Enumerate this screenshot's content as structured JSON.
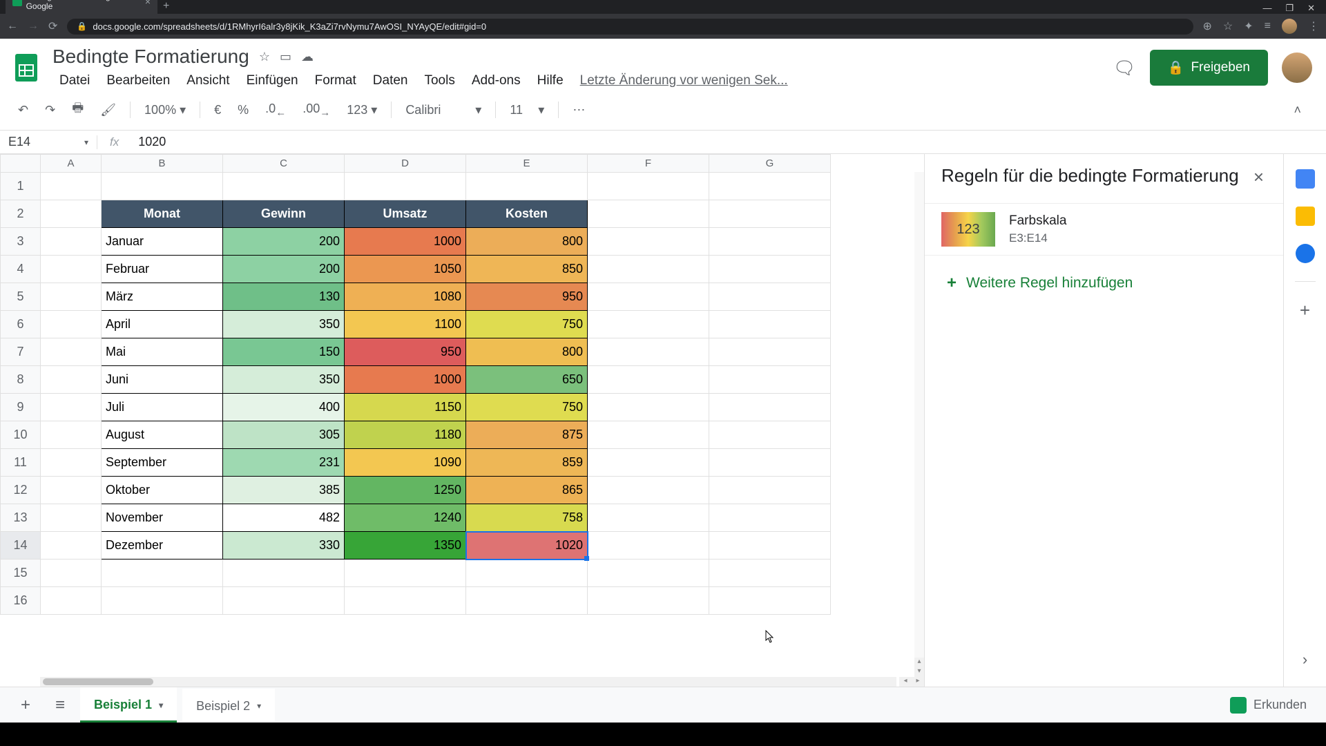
{
  "browser": {
    "tab_title": "Bedingte Formatierung - Google",
    "url": "docs.google.com/spreadsheets/d/1RMhyrI6alr3y8jKik_K3aZi7rvNymu7AwOSI_NYAyQE/edit#gid=0"
  },
  "doc": {
    "title": "Bedingte Formatierung",
    "last_edit": "Letzte Änderung vor wenigen Sek..."
  },
  "menu": {
    "file": "Datei",
    "edit": "Bearbeiten",
    "view": "Ansicht",
    "insert": "Einfügen",
    "format": "Format",
    "data": "Daten",
    "tools": "Tools",
    "addons": "Add-ons",
    "help": "Hilfe"
  },
  "share_btn": "Freigeben",
  "toolbar": {
    "zoom": "100%",
    "currency": "€",
    "percent": "%",
    "dec_less": ".0",
    "dec_more": ".00",
    "numfmt": "123",
    "font": "Calibri",
    "size": "11"
  },
  "cell_ref": "E14",
  "formula": "1020",
  "columns": [
    "A",
    "B",
    "C",
    "D",
    "E",
    "F",
    "G"
  ],
  "table": {
    "headers": {
      "monat": "Monat",
      "gewinn": "Gewinn",
      "umsatz": "Umsatz",
      "kosten": "Kosten"
    },
    "rows": [
      {
        "monat": "Januar",
        "gewinn": "200",
        "umsatz": "1000",
        "kosten": "800",
        "gc": "#8dd1a3",
        "uc": "#e77a4f",
        "kc": "#ecad58"
      },
      {
        "monat": "Februar",
        "gewinn": "200",
        "umsatz": "1050",
        "kosten": "850",
        "gc": "#8dd1a3",
        "uc": "#eb9751",
        "kc": "#efb656"
      },
      {
        "monat": "März",
        "gewinn": "130",
        "umsatz": "1080",
        "kosten": "950",
        "gc": "#6fbf88",
        "uc": "#efb054",
        "kc": "#e68952"
      },
      {
        "monat": "April",
        "gewinn": "350",
        "umsatz": "1100",
        "kosten": "750",
        "gc": "#d5edd9",
        "uc": "#f3c751",
        "kc": "#dfdc50"
      },
      {
        "monat": "Mai",
        "gewinn": "150",
        "umsatz": "950",
        "kosten": "800",
        "gc": "#79c793",
        "uc": "#dd5c5c",
        "kc": "#efbe52"
      },
      {
        "monat": "Juni",
        "gewinn": "350",
        "umsatz": "1000",
        "kosten": "650",
        "gc": "#d5edd9",
        "uc": "#e77a4f",
        "kc": "#7bc07c"
      },
      {
        "monat": "Juli",
        "gewinn": "400",
        "umsatz": "1150",
        "kosten": "750",
        "gc": "#e6f4e8",
        "uc": "#d6d84e",
        "kc": "#dfdc50"
      },
      {
        "monat": "August",
        "gewinn": "305",
        "umsatz": "1180",
        "kosten": "875",
        "gc": "#bee3c6",
        "uc": "#c0d24e",
        "kc": "#ecad58"
      },
      {
        "monat": "September",
        "gewinn": "231",
        "umsatz": "1090",
        "kosten": "859",
        "gc": "#9ed9b1",
        "uc": "#f3c751",
        "kc": "#eeb756"
      },
      {
        "monat": "Oktober",
        "gewinn": "385",
        "umsatz": "1250",
        "kosten": "865",
        "gc": "#dff0e1",
        "uc": "#63b662",
        "kc": "#eeb255"
      },
      {
        "monat": "November",
        "gewinn": "482",
        "umsatz": "1240",
        "kosten": "758",
        "gc": "#ffffff",
        "uc": "#6fbc68",
        "kc": "#d8da4f"
      },
      {
        "monat": "Dezember",
        "gewinn": "330",
        "umsatz": "1350",
        "kosten": "1020",
        "gc": "#cbe9d1",
        "uc": "#37a537",
        "kc": "#de7373"
      }
    ]
  },
  "cf": {
    "title": "Regeln für die bedingte Formatierung",
    "swatch_text": "123",
    "rule_name": "Farbskala",
    "rule_range": "E3:E14",
    "add_rule": "Weitere Regel hinzufügen"
  },
  "sheets": {
    "tab1": "Beispiel 1",
    "tab2": "Beispiel 2",
    "explore": "Erkunden"
  },
  "chart_data": {
    "type": "table",
    "title": "Bedingte Formatierung",
    "columns": [
      "Monat",
      "Gewinn",
      "Umsatz",
      "Kosten"
    ],
    "rows": [
      [
        "Januar",
        200,
        1000,
        800
      ],
      [
        "Februar",
        200,
        1050,
        850
      ],
      [
        "März",
        130,
        1080,
        950
      ],
      [
        "April",
        350,
        1100,
        750
      ],
      [
        "Mai",
        150,
        950,
        800
      ],
      [
        "Juni",
        350,
        1000,
        650
      ],
      [
        "Juli",
        400,
        1150,
        750
      ],
      [
        "August",
        305,
        1180,
        875
      ],
      [
        "September",
        231,
        1090,
        859
      ],
      [
        "Oktober",
        385,
        1250,
        865
      ],
      [
        "November",
        482,
        1240,
        758
      ],
      [
        "Dezember",
        330,
        1350,
        1020
      ]
    ]
  }
}
